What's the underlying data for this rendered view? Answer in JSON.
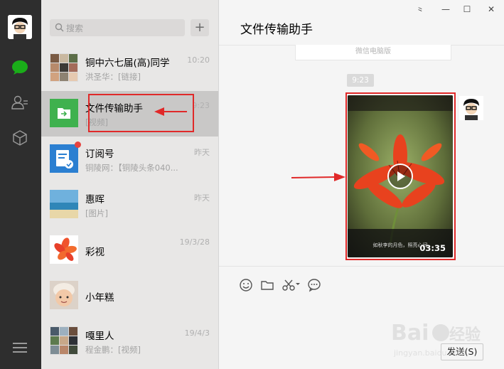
{
  "search": {
    "placeholder": "搜索"
  },
  "list_add_label": "+",
  "chats": [
    {
      "name": "铜中六七届(高)同学",
      "sub": "洪圣华：[链接]",
      "time": "10:20"
    },
    {
      "name": "文件传输助手",
      "sub": "[视频]",
      "time": "9:23",
      "active": true
    },
    {
      "name": "订阅号",
      "sub": "铜陵网：【铜陵头条040...",
      "time": "昨天"
    },
    {
      "name": "惠晖",
      "sub": "[图片]",
      "time": "昨天"
    },
    {
      "name": "彩视",
      "sub": "",
      "time": "19/3/28"
    },
    {
      "name": "小年糕",
      "sub": "",
      "time": ""
    },
    {
      "name": "嘎里人",
      "sub": "程金鹏：[视频]",
      "time": "19/4/3"
    }
  ],
  "conversation": {
    "title": "文件传输助手",
    "prev_message": "微信电脑版",
    "timestamp": "9:23",
    "video": {
      "caption": "如秋李的月色，照亮心间",
      "duration": "03:35"
    }
  },
  "window_controls": {
    "pin": "⺀",
    "minimize": "—",
    "maximize": "☐",
    "close": "✕"
  },
  "compose": {
    "send_label": "发送(S)"
  },
  "watermark": {
    "brand": "Baidu经验",
    "url": "jingyan.baidu.com"
  },
  "colors": {
    "accent": "#1aad19",
    "highlight": "#e02929",
    "rail": "#2e2e2e"
  },
  "icons": {
    "rail": [
      "chat-icon",
      "contacts-icon",
      "favorites-cube-icon",
      "menu-icon"
    ],
    "compose": [
      "emoji-icon",
      "folder-icon",
      "scissors-icon",
      "chat-bubble-icon"
    ]
  }
}
